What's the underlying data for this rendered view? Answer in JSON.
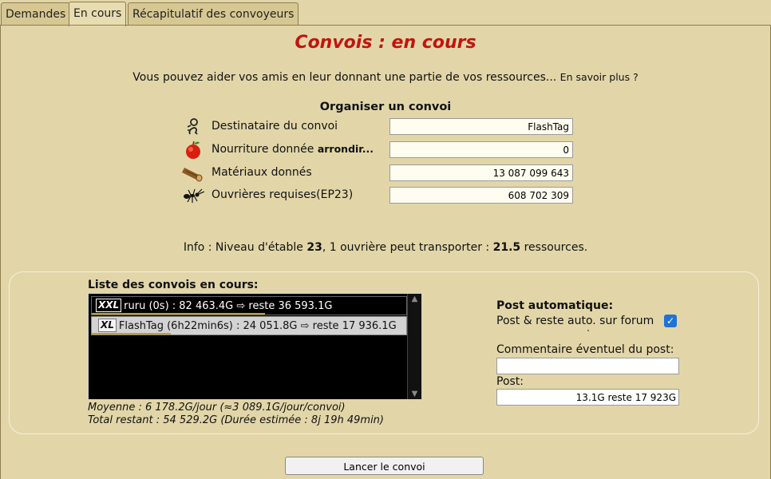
{
  "tabs": [
    {
      "label": "Demandes"
    },
    {
      "label": "En cours",
      "active": true
    },
    {
      "label": "Récapitulatif des convoyeurs"
    }
  ],
  "title": "Convois : en cours",
  "intro": {
    "text": "Vous pouvez aider vos amis en leur donnant une partie de vos ressources...",
    "more": "En savoir plus ?"
  },
  "organiser": {
    "title": "Organiser un convoi",
    "rows": [
      {
        "icon": "recipient-icon",
        "label": "Destinataire du convoi",
        "value": "FlashTag"
      },
      {
        "icon": "apple-icon",
        "label": "Nourriture donnée",
        "extra": "arrondir...",
        "value": "0"
      },
      {
        "icon": "wood-icon",
        "label": "Matériaux donnés",
        "value": "13 087 099 643"
      },
      {
        "icon": "ant-icon",
        "label": "Ouvrières requises(EP23)",
        "value": "608 702 309"
      }
    ]
  },
  "info": {
    "prefix": "Info : Niveau d'étable",
    "level": "23",
    "mid": ", 1 ouvrière peut transporter :",
    "amount": "21.5",
    "suffix": "ressources."
  },
  "convoys": {
    "title": "Liste des convois en cours:",
    "items": [
      {
        "tag": "XXL",
        "text": "ruru (0s) : 82 463.4G ⇨ reste 36 593.1G",
        "progress": 0.55
      },
      {
        "tag": "XL",
        "text": "FlashTag (6h22min6s) : 24 051.8G ⇨ reste 17 936.1G",
        "progress": 0.25
      }
    ],
    "average": "Moyenne : 6 178.2G/jour (≈3 089.1G/jour/convoi)",
    "total": "Total restant : 54 529.2G (Durée estimée : 8j 19h 49min)"
  },
  "auto_post": {
    "title": "Post automatique:",
    "label": "Post & reste auto. sur forum",
    "checked": true,
    "comment_label": "Commentaire éventuel du post:",
    "comment_value": "",
    "post_label": "Post:",
    "post_value": "13.1G reste 17 923G"
  },
  "launch_label": "Lancer le convoi",
  "colors": {
    "background": "#e2d6a9",
    "title": "#c0150f",
    "checkbox": "#1f73d6",
    "progress": "#c9a01e"
  }
}
